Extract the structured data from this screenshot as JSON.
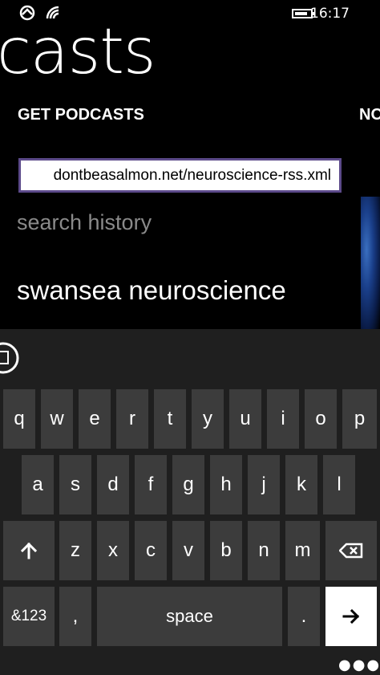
{
  "status_bar": {
    "time": "16:17"
  },
  "header": {
    "title": "casts"
  },
  "pivot": {
    "items": [
      "GET PODCASTS",
      "NO"
    ]
  },
  "url_field": {
    "value": "dontbeasalmon.net/neuroscience-rss.xml"
  },
  "search_history": {
    "label": "search history",
    "items": [
      "swansea neuroscience"
    ]
  },
  "keyboard": {
    "row1": [
      "q",
      "w",
      "e",
      "r",
      "t",
      "y",
      "u",
      "i",
      "o",
      "p"
    ],
    "row2": [
      "a",
      "s",
      "d",
      "f",
      "g",
      "h",
      "j",
      "k",
      "l"
    ],
    "row3": [
      "z",
      "x",
      "c",
      "v",
      "b",
      "n",
      "m"
    ],
    "symbols_label": "&123",
    "comma_label": ",",
    "space_label": "space",
    "period_label": ".",
    "shift_icon": "shift-arrow-icon",
    "backspace_icon": "backspace-icon",
    "enter_icon": "enter-arrow-icon"
  },
  "colors": {
    "field_border": "#5c4a8a",
    "key_bg": "#3c3c3c",
    "keyboard_bg": "#1f1f1f"
  }
}
